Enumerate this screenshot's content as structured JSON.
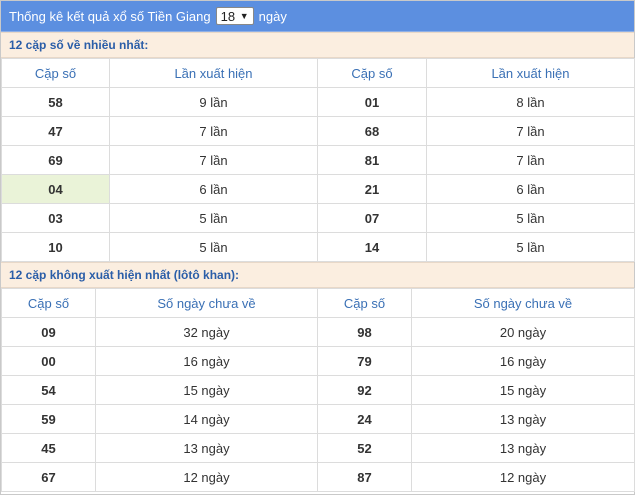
{
  "header": {
    "title_prefix": "Thống kê kết quả xổ số Tiền Giang",
    "days_value": "18",
    "title_suffix": "ngày"
  },
  "frequent": {
    "heading": "12 cặp số về nhiều nhất:",
    "col_pair": "Cặp số",
    "col_count": "Lần xuất hiện",
    "rows": [
      {
        "a": "58",
        "a_count": "9 lần",
        "b": "01",
        "b_count": "8 lần"
      },
      {
        "a": "47",
        "a_count": "7 lần",
        "b": "68",
        "b_count": "7 lần"
      },
      {
        "a": "69",
        "a_count": "7 lần",
        "b": "81",
        "b_count": "7 lần"
      },
      {
        "a": "04",
        "a_count": "6 lần",
        "b": "21",
        "b_count": "6 lần"
      },
      {
        "a": "03",
        "a_count": "5 lần",
        "b": "07",
        "b_count": "5 lần"
      },
      {
        "a": "10",
        "a_count": "5 lần",
        "b": "14",
        "b_count": "5 lần"
      }
    ]
  },
  "absent": {
    "heading": "12 cặp không xuất hiện nhất (lôtô khan):",
    "col_pair": "Cặp số",
    "col_days": "Số ngày chưa về",
    "rows": [
      {
        "a": "09",
        "a_days": "32 ngày",
        "b": "98",
        "b_days": "20 ngày"
      },
      {
        "a": "00",
        "a_days": "16 ngày",
        "b": "79",
        "b_days": "16 ngày"
      },
      {
        "a": "54",
        "a_days": "15 ngày",
        "b": "92",
        "b_days": "15 ngày"
      },
      {
        "a": "59",
        "a_days": "14 ngày",
        "b": "24",
        "b_days": "13 ngày"
      },
      {
        "a": "45",
        "a_days": "13 ngày",
        "b": "52",
        "b_days": "13 ngày"
      },
      {
        "a": "67",
        "a_days": "12 ngày",
        "b": "87",
        "b_days": "12 ngày"
      }
    ]
  }
}
